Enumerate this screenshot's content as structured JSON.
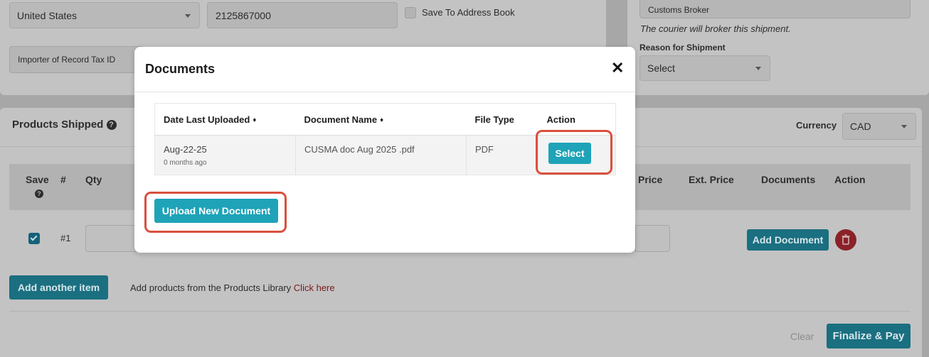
{
  "background": {
    "country_value": "United States",
    "phone_value": "2125867000",
    "save_address_label": "Save To Address Book",
    "importer_tax_placeholder": "Importer of Record Tax ID",
    "customs_broker_value": "Customs Broker",
    "broker_note": "The courier will broker this shipment.",
    "reason_label": "Reason for Shipment",
    "reason_value": "Select",
    "products_shipped_title": "Products Shipped",
    "currency_label": "Currency",
    "currency_value": "CAD",
    "table_headers": {
      "save": "Save",
      "number": "#",
      "qty": "Qty",
      "price": "Price",
      "ext_price": "Ext. Price",
      "documents": "Documents",
      "action": "Action"
    },
    "row_number": "#1",
    "add_document_label": "Add Document",
    "add_another_item_label": "Add another item",
    "products_library_text": "Add products from the Products Library",
    "click_here_label": "Click here",
    "clear_label": "Clear",
    "finalize_label": "Finalize & Pay"
  },
  "modal": {
    "title": "Documents",
    "close_symbol": "✕",
    "columns": {
      "date": "Date Last Uploaded",
      "name": "Document Name",
      "type": "File Type",
      "action": "Action"
    },
    "rows": [
      {
        "date": "Aug-22-25",
        "age": "0 months ago",
        "name": "CUSMA doc Aug 2025 .pdf",
        "type": "PDF",
        "action": "Select"
      }
    ],
    "upload_label": "Upload New Document"
  },
  "colors": {
    "accent": "#1ea3b8",
    "highlight": "#d9503e",
    "danger": "#b5262e"
  }
}
